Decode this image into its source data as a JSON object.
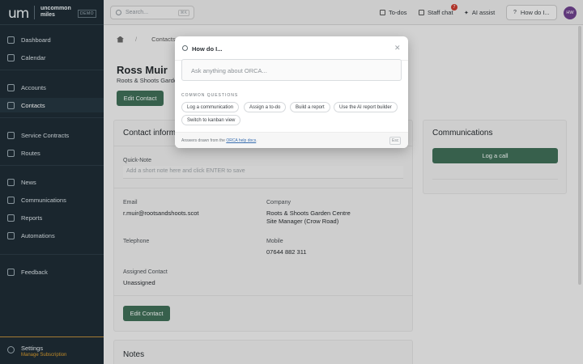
{
  "brand": {
    "mark": "um",
    "name_line1": "uncommon",
    "name_line2": "miles",
    "demo_badge": "DEMO"
  },
  "sidebar": {
    "items": [
      {
        "label": "Dashboard"
      },
      {
        "label": "Calendar"
      },
      {
        "label": "Accounts"
      },
      {
        "label": "Contacts"
      },
      {
        "label": "Service Contracts"
      },
      {
        "label": "Routes"
      },
      {
        "label": "News"
      },
      {
        "label": "Communications"
      },
      {
        "label": "Reports"
      },
      {
        "label": "Automations"
      },
      {
        "label": "Feedback"
      }
    ],
    "settings_label": "Settings",
    "settings_sub": "Manage Subscription"
  },
  "topbar": {
    "search_placeholder": "Search...",
    "search_kbd": "⌘K",
    "todos": "To-dos",
    "staff_chat": "Staff chat",
    "staff_chat_badge": "7",
    "ai_assist": "AI assist",
    "how_do_i": "How do I...",
    "avatar_initials": "HW"
  },
  "breadcrumb": {
    "current": "Contacts"
  },
  "contact": {
    "name": "Ross Muir",
    "subtitle": "Roots & Shoots Garden Centre",
    "edit_button": "Edit Contact",
    "info_title": "Contact information",
    "quick_note_label": "Quick-Note",
    "quick_note_placeholder": "Add a short note here and click ENTER to save",
    "email_label": "Email",
    "email": "r.muir@rootsandshoots.scot",
    "company_label": "Company",
    "company": "Roots & Shoots Garden Centre",
    "company_role": "Site Manager (Crow Road)",
    "telephone_label": "Telephone",
    "mobile_label": "Mobile",
    "mobile": "07644 882 311",
    "assigned_label": "Assigned Contact",
    "assigned": "Unassigned",
    "edit_button_bottom": "Edit Contact",
    "notes_title": "Notes"
  },
  "communications": {
    "title": "Communications",
    "log_call": "Log a call"
  },
  "modal": {
    "title": "How do I...",
    "input_placeholder": "Ask anything about ORCA...",
    "common_label": "COMMON QUESTIONS",
    "chips": [
      "Log a communication",
      "Assign a to-do",
      "Build a report",
      "Use the AI report builder",
      "Switch to kanban view"
    ],
    "footer_prefix": "Answers drawn from the ",
    "footer_link": "ORCA help docs",
    "footer_suffix": ".",
    "esc": "Esc"
  }
}
